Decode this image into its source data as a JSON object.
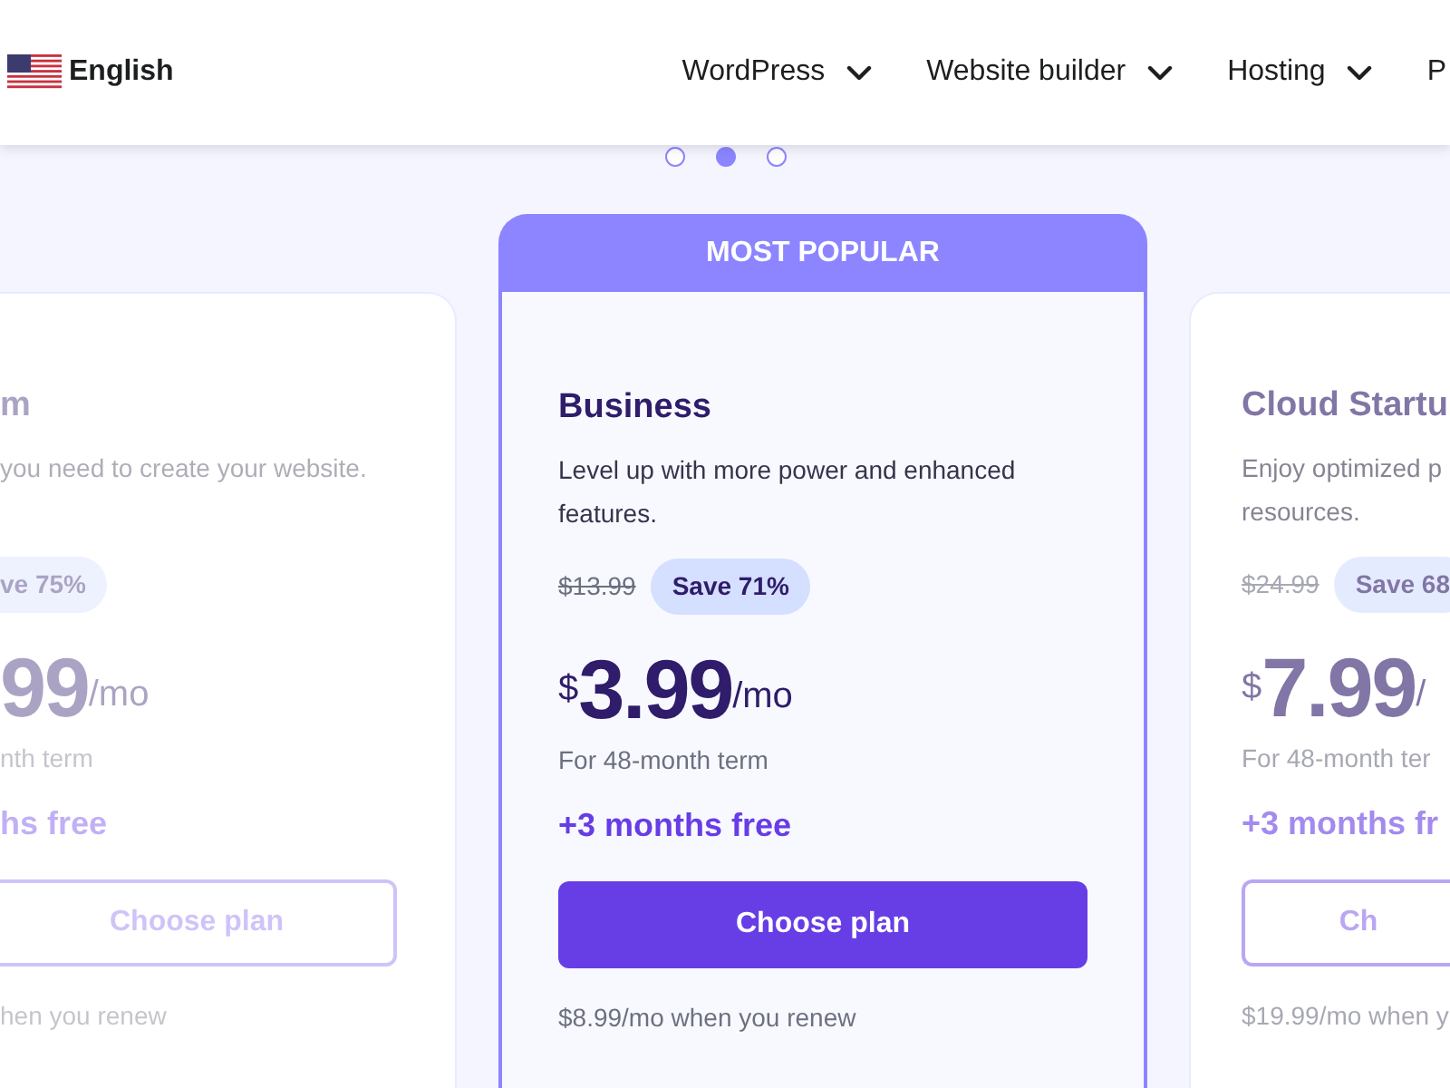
{
  "header": {
    "language": "English",
    "nav": [
      {
        "label": "WordPress",
        "dropdown": true
      },
      {
        "label": "Website builder",
        "dropdown": true
      },
      {
        "label": "Hosting",
        "dropdown": true
      },
      {
        "label": "P",
        "dropdown": false
      }
    ]
  },
  "carousel_dots": [
    {
      "selected": false
    },
    {
      "selected": true
    },
    {
      "selected": false
    }
  ],
  "plans": [
    {
      "kind": "partial_left",
      "name": "m",
      "description": "you need to create your website.",
      "badge": "ve 75%",
      "amount": "99",
      "unit": "/mo",
      "term": "nth term",
      "bonus": "hs free",
      "button": "Choose plan",
      "renew": "hen you renew"
    },
    {
      "kind": "featured",
      "ribbon": "MOST POPULAR",
      "name": "Business",
      "description": "Level up with more power and enhanced features.",
      "old_price": "$13.99",
      "badge": "Save 71%",
      "currency": "$",
      "amount": "3.99",
      "unit": "/mo",
      "term": "For 48-month term",
      "bonus": "+3 months free",
      "button": "Choose plan",
      "renew": "$8.99/mo when you renew"
    },
    {
      "kind": "partial_right",
      "name": "Cloud Startu",
      "description": "Enjoy optimized p",
      "description_2": "resources.",
      "old_price": "$24.99",
      "badge": "Save 68",
      "currency": "$",
      "amount": "7.99",
      "unit": "/",
      "term": "For 48-month ter",
      "bonus": "+3 months fr",
      "button": "Ch",
      "renew": "$19.99/mo when y"
    }
  ]
}
